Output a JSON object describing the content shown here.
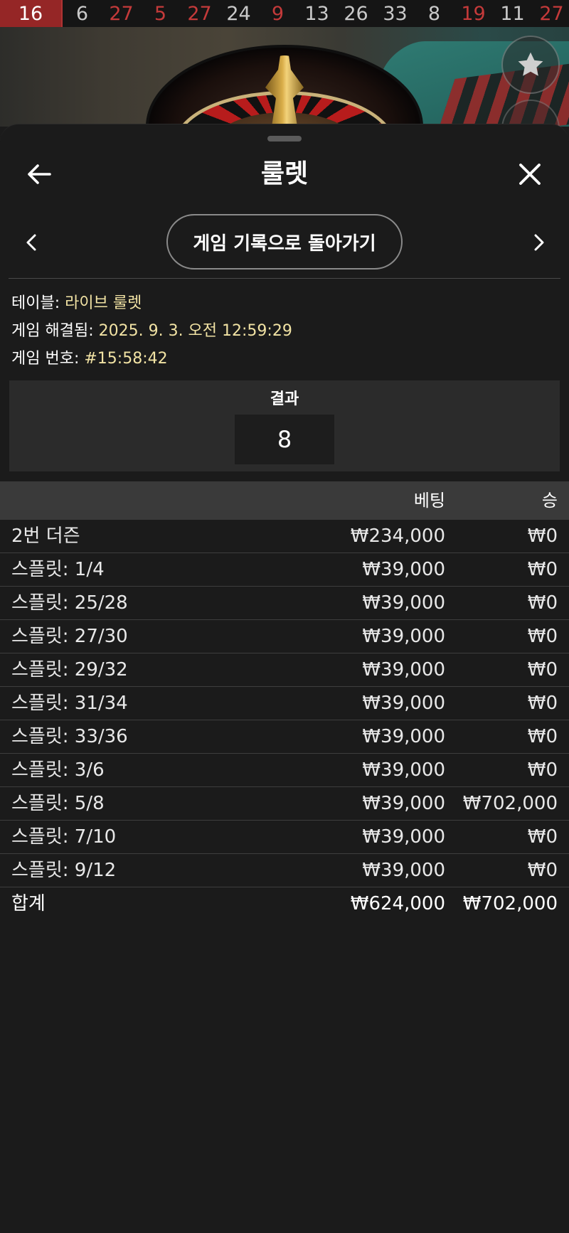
{
  "history": [
    {
      "value": "16",
      "color": "red"
    },
    {
      "value": "6",
      "color": "black"
    },
    {
      "value": "27",
      "color": "red"
    },
    {
      "value": "5",
      "color": "red"
    },
    {
      "value": "27",
      "color": "red"
    },
    {
      "value": "24",
      "color": "black"
    },
    {
      "value": "9",
      "color": "red"
    },
    {
      "value": "13",
      "color": "black"
    },
    {
      "value": "26",
      "color": "black"
    },
    {
      "value": "33",
      "color": "black"
    },
    {
      "value": "8",
      "color": "black"
    },
    {
      "value": "19",
      "color": "red"
    },
    {
      "value": "11",
      "color": "black"
    },
    {
      "value": "27",
      "color": "red"
    }
  ],
  "header": {
    "title": "룰렛",
    "back_icon": "arrow-left-icon",
    "close_icon": "close-icon"
  },
  "nav": {
    "history_button": "게임 기록으로 돌아가기",
    "prev_icon": "chevron-left-icon",
    "next_icon": "chevron-right-icon"
  },
  "info": {
    "table_label": "테이블: ",
    "table_value": "라이브 룰렛",
    "resolved_label": "게임 해결됨: ",
    "resolved_value": "2025. 9. 3. 오전 12:59:29",
    "game_no_label": "게임 번호: ",
    "game_no_value": "#15:58:42"
  },
  "result": {
    "label": "결과",
    "value": "8"
  },
  "table": {
    "headers": {
      "name": "",
      "bet": "베팅",
      "win": "승"
    },
    "rows": [
      {
        "name": "2번 더즌",
        "bet": "₩234,000",
        "win": "₩0"
      },
      {
        "name": "스플릿: 1/4",
        "bet": "₩39,000",
        "win": "₩0"
      },
      {
        "name": "스플릿: 25/28",
        "bet": "₩39,000",
        "win": "₩0"
      },
      {
        "name": "스플릿: 27/30",
        "bet": "₩39,000",
        "win": "₩0"
      },
      {
        "name": "스플릿: 29/32",
        "bet": "₩39,000",
        "win": "₩0"
      },
      {
        "name": "스플릿: 31/34",
        "bet": "₩39,000",
        "win": "₩0"
      },
      {
        "name": "스플릿: 33/36",
        "bet": "₩39,000",
        "win": "₩0"
      },
      {
        "name": "스플릿: 3/6",
        "bet": "₩39,000",
        "win": "₩0"
      },
      {
        "name": "스플릿: 5/8",
        "bet": "₩39,000",
        "win": "₩702,000"
      },
      {
        "name": "스플릿: 7/10",
        "bet": "₩39,000",
        "win": "₩0"
      },
      {
        "name": "스플릿: 9/12",
        "bet": "₩39,000",
        "win": "₩0"
      }
    ],
    "total": {
      "name": "합계",
      "bet": "₩624,000",
      "win": "₩702,000"
    }
  },
  "colors": {
    "accent_value": "#f2e3a4",
    "red_number": "#c43a3a",
    "highlight_bg": "#952626",
    "sheet_bg": "#1b1b1b"
  }
}
